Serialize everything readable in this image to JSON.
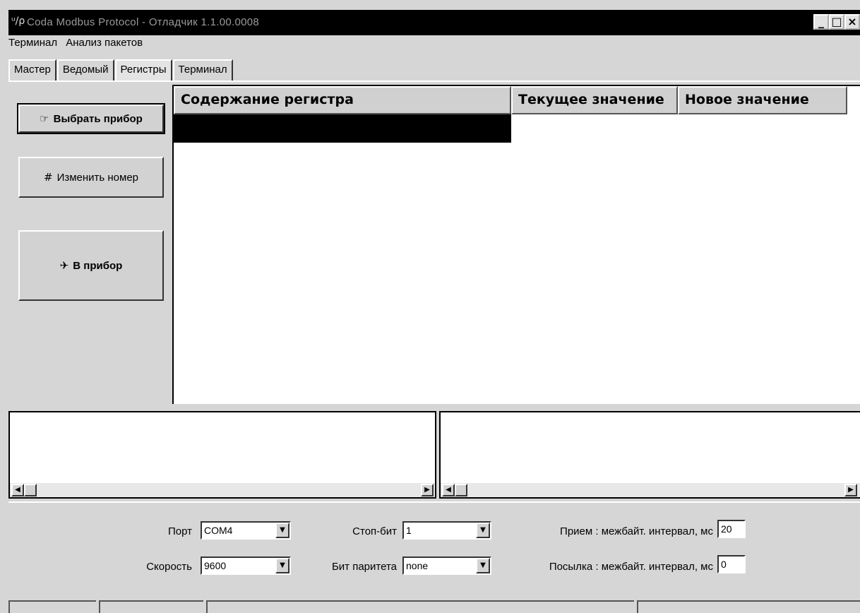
{
  "window": {
    "icon": "app-icon",
    "title": "Coda Modbus Protocol - Отладчик 1.1.00.0008",
    "minimize_glyph": "_",
    "maximize_glyph": "□",
    "close_glyph": "×"
  },
  "menu": [
    "Терминал",
    "Анализ пакетов"
  ],
  "tabs": [
    {
      "label": "Мастер",
      "active": false
    },
    {
      "label": "Ведомый",
      "active": false
    },
    {
      "label": "Регистры",
      "active": true
    },
    {
      "label": "Терминал",
      "active": false
    }
  ],
  "buttons": {
    "select_device": {
      "label": "Выбрать прибор",
      "icon": "hand-pointer-icon",
      "glyph": "☞"
    },
    "change_number": {
      "label": "Изменить номер",
      "icon": "hash-icon",
      "glyph": "#"
    },
    "to_device": {
      "label": "В прибор",
      "icon": "pin-icon",
      "glyph": "✈"
    }
  },
  "grid": {
    "headers": [
      "Содержание регистра",
      "Текущее значение",
      "Новое значение"
    ],
    "selected_row": 0
  },
  "scroll": {
    "left": "◀",
    "right": "▶"
  },
  "settings": {
    "port_label": "Порт",
    "port_value": "COM4",
    "speed_label": "Скорость",
    "speed_value": "9600",
    "stopbit_label": "Стоп-бит",
    "stopbit_value": "1",
    "parity_label": "Бит паритета",
    "parity_value": "none",
    "rx_label": "Прием : межбайт. интервал, мс",
    "rx_value": "20",
    "tx_label": "Посылка : межбайт. интервал, мс",
    "tx_value": "0",
    "dropdown_glyph": "▼"
  }
}
